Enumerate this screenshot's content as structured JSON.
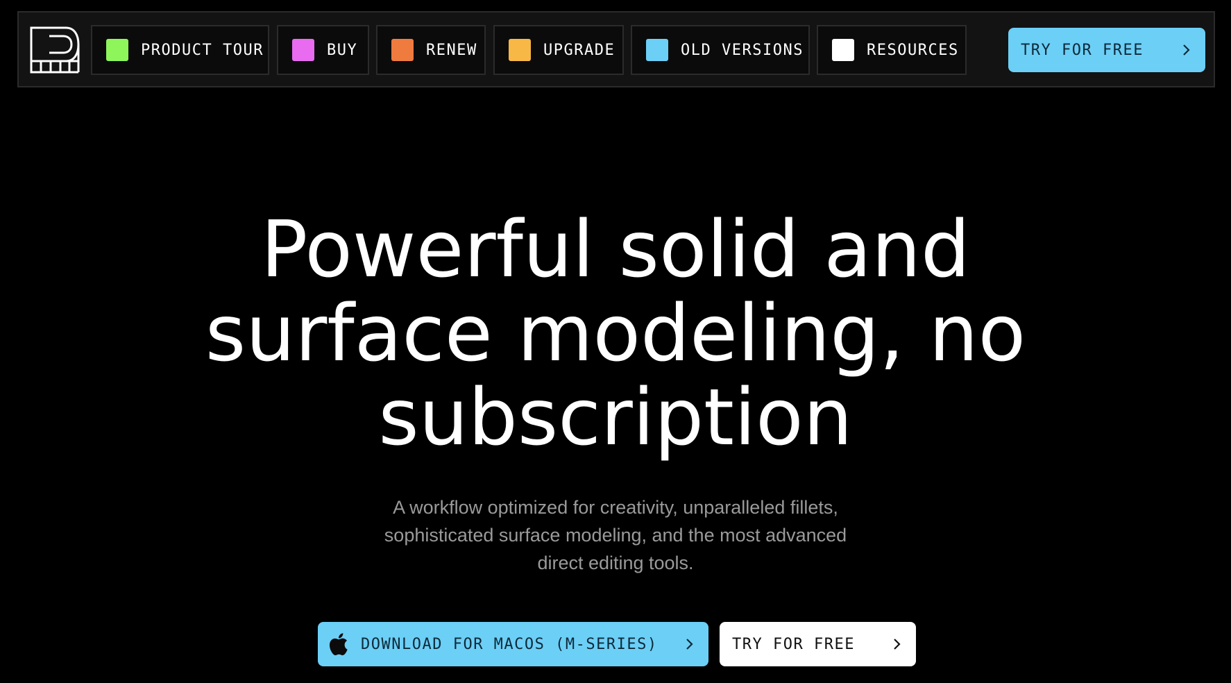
{
  "colors": {
    "background": "#000000",
    "navbar_background": "#131313",
    "accent_blue": "#6ccff6",
    "subtitle_gray": "#9a9a9a"
  },
  "nav": {
    "logo_icon": "plasticity-logo-icon",
    "items": [
      {
        "label": "PRODUCT TOUR",
        "swatch": "#8ef55a"
      },
      {
        "label": "BUY",
        "swatch": "#e86bf0"
      },
      {
        "label": "RENEW",
        "swatch": "#f07b3f"
      },
      {
        "label": "UPGRADE",
        "swatch": "#f7b845"
      },
      {
        "label": "OLD VERSIONS",
        "swatch": "#6ccff6"
      },
      {
        "label": "RESOURCES",
        "swatch": "#ffffff"
      }
    ],
    "cta_label": "TRY FOR FREE"
  },
  "hero": {
    "title_lines": [
      "Powerful solid and",
      "surface modeling, no",
      "subscription"
    ],
    "subtitle_lines": [
      "A workflow optimized for creativity, unparalleled fillets,",
      "sophisticated surface modeling, and the most advanced",
      "direct editing tools."
    ],
    "download_label": "DOWNLOAD FOR MACOS (M-SERIES)",
    "download_icon": "apple-icon",
    "try_label": "TRY FOR FREE"
  }
}
